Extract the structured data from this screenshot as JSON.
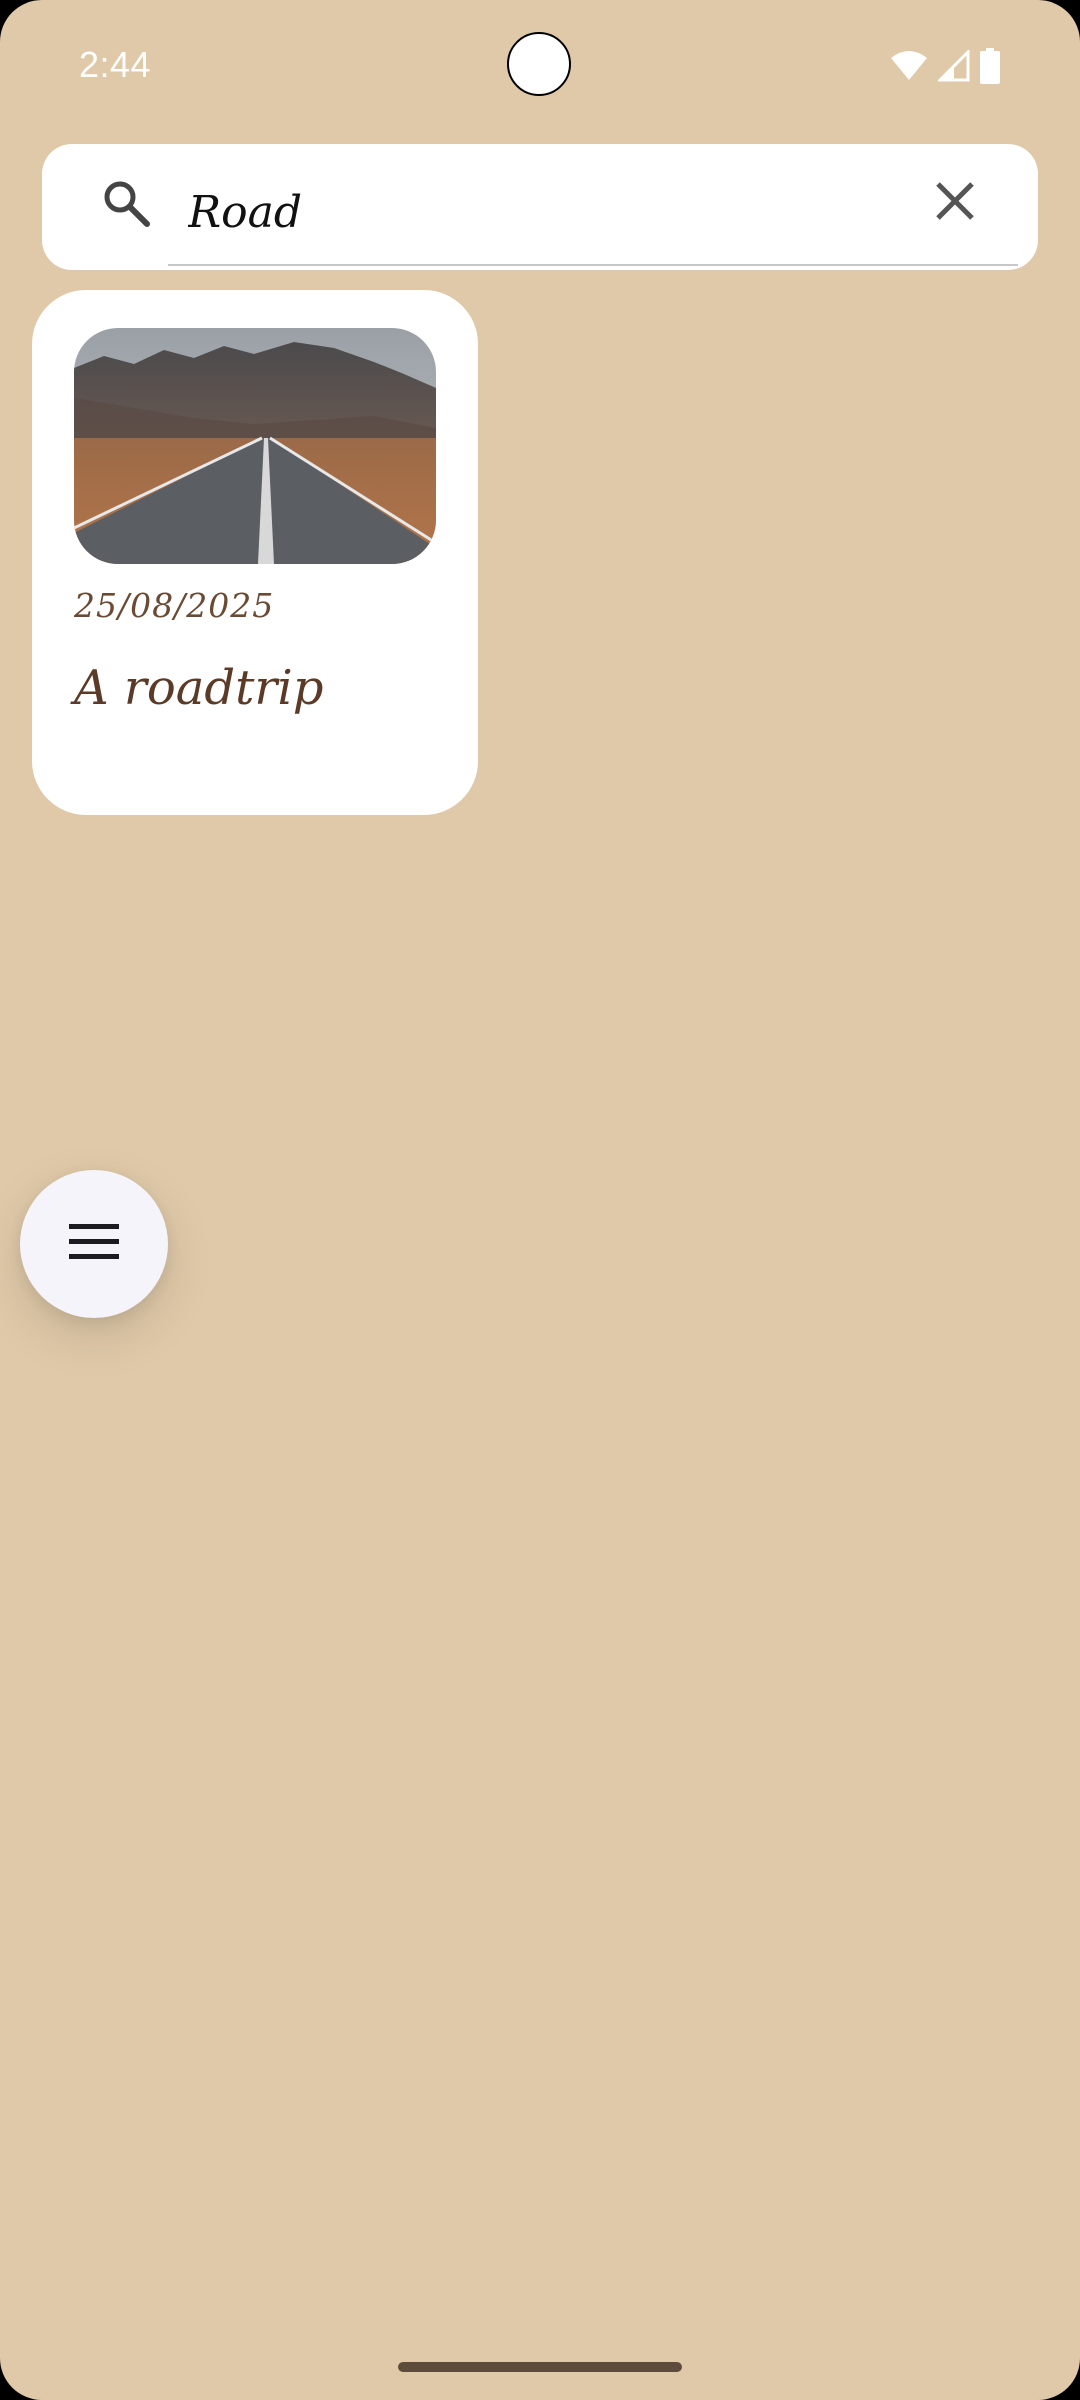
{
  "status_bar": {
    "time": "2:44",
    "icons": [
      "wifi-icon",
      "cellular-signal-icon",
      "battery-icon"
    ]
  },
  "search": {
    "query": "Road",
    "icon": "search-icon",
    "clear_icon": "close-icon"
  },
  "notes": [
    {
      "image": "mountain-road-photo",
      "date": "25/08/2025",
      "title": "A roadtrip"
    }
  ],
  "fab": {
    "icon": "menu-icon"
  },
  "colors": {
    "background": "#dfc9a8",
    "card": "#ffffff",
    "note_text": "#5b3b27",
    "fab": "#f6f4fb"
  }
}
